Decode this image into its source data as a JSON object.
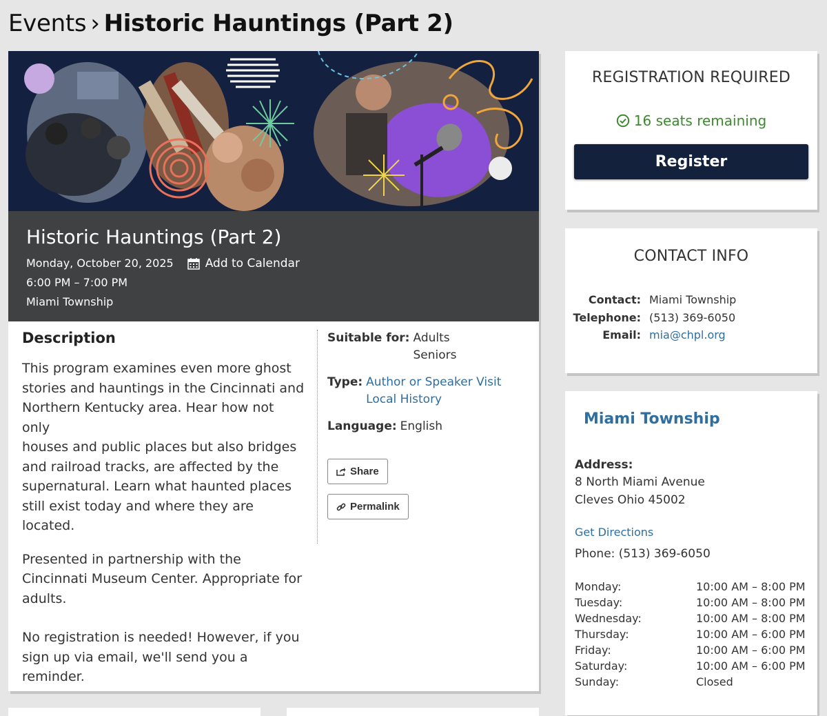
{
  "breadcrumb": {
    "parent": "Events",
    "separator": "›",
    "current": "Historic Hauntings (Part 2)"
  },
  "event": {
    "title": "Historic Hauntings (Part 2)",
    "date": "Monday, October 20, 2025",
    "add_to_calendar": "Add to Calendar",
    "time": "6:00 PM – 7:00 PM",
    "location": "Miami Township"
  },
  "description": {
    "heading": "Description",
    "paragraphs": [
      "This program examines even more ghost\nstories and hauntings in the Cincinnati and\nNorthern Kentucky area. Hear how not only\nhouses and public places but also bridges\nand railroad tracks, are affected by the\nsupernatural. Learn what haunted places\nstill exist today and where they are located.",
      "Presented in partnership with the\nCincinnati Museum Center. Appropriate for\nadults.",
      "No registration is needed! However, if you\nsign up via email, we'll send you a\nreminder."
    ]
  },
  "details": {
    "suitable_label": "Suitable for:",
    "suitable_values": [
      "Adults",
      "Seniors"
    ],
    "type_label": "Type:",
    "type_values": [
      "Author or Speaker Visit",
      "Local History"
    ],
    "language_label": "Language:",
    "language_value": "English",
    "share_label": "Share",
    "permalink_label": "Permalink"
  },
  "registration": {
    "heading": "REGISTRATION REQUIRED",
    "seats": "16 seats remaining",
    "register_label": "Register"
  },
  "contact": {
    "heading": "CONTACT INFO",
    "contact_label": "Contact:",
    "contact_value": "Miami Township",
    "telephone_label": "Telephone:",
    "telephone_value": "(513) 369-6050",
    "email_label": "Email:",
    "email_value": "mia@chpl.org"
  },
  "location": {
    "name": "Miami Township",
    "address_label": "Address:",
    "address_line1": "8 North Miami Avenue",
    "address_line2": "Cleves Ohio 45002",
    "directions_label": "Get Directions",
    "phone": "Phone: (513) 369-6050",
    "hours": [
      {
        "day": "Monday:",
        "time": "10:00 AM – 8:00 PM"
      },
      {
        "day": "Tuesday:",
        "time": "10:00 AM – 8:00 PM"
      },
      {
        "day": "Wednesday:",
        "time": "10:00 AM – 8:00 PM"
      },
      {
        "day": "Thursday:",
        "time": "10:00 AM – 6:00 PM"
      },
      {
        "day": "Friday:",
        "time": "10:00 AM – 6:00 PM"
      },
      {
        "day": "Saturday:",
        "time": "10:00 AM – 6:00 PM"
      },
      {
        "day": "Sunday:",
        "time": "Closed"
      }
    ]
  },
  "colors": {
    "hero_bg": "#13203f",
    "info_band": "#3f4143",
    "link": "#2f6e9e",
    "success": "#3c8a2e",
    "register_button": "#14213d"
  },
  "icons": {
    "calendar": "calendar-icon",
    "check": "check-circle-icon",
    "share": "share-icon",
    "permalink": "link-icon"
  }
}
